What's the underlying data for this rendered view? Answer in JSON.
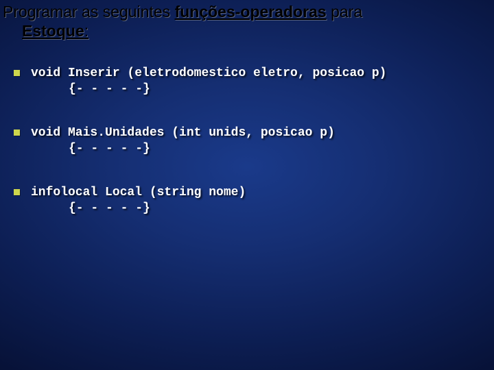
{
  "title": {
    "line1_prefix": "Programar as seguintes ",
    "line1_bold": "funções-operadoras",
    "line1_suffix": " para",
    "line2_bold": "Estoque",
    "line2_suffix": ":"
  },
  "items": [
    {
      "signature": "void Inserir (eletrodomestico eletro, posicao p)",
      "body": "{- - - - -}"
    },
    {
      "signature": "void Mais.Unidades (int unids, posicao p)",
      "body": "{- - - - -}"
    },
    {
      "signature": "infolocal Local (string nome)",
      "body": "{- - - - -}"
    }
  ]
}
